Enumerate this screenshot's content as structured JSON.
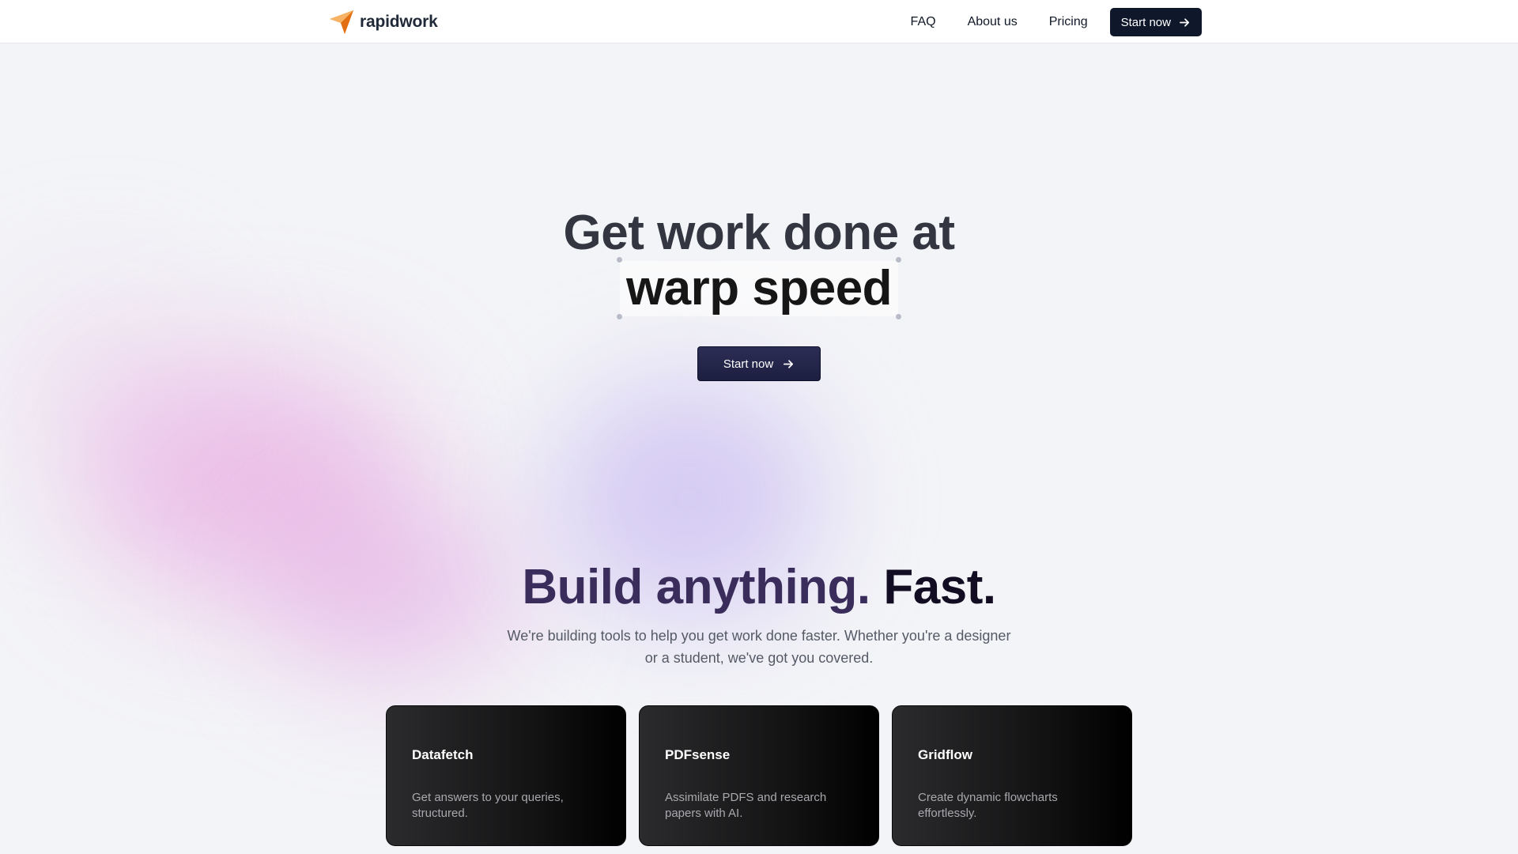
{
  "brand": {
    "name": "rapidwork",
    "accent": "#f28a2c"
  },
  "nav": {
    "links": [
      "FAQ",
      "About us",
      "Pricing"
    ],
    "cta_label": "Start now",
    "cta_icon": "arrow-right-icon"
  },
  "hero": {
    "line1": "Get work done at",
    "line2": "warp speed",
    "cta_label": "Start now",
    "cta_icon": "arrow-right-icon"
  },
  "section": {
    "title_part1": "Build anything.",
    "title_part2": "Fast.",
    "subtitle": "We're building tools to help you get work done faster. Whether you're a designer or a student, we've got you covered."
  },
  "cards": [
    {
      "title": "Datafetch",
      "description": "Get answers to your queries, structured."
    },
    {
      "title": "PDFsense",
      "description": "Assimilate PDFS and research papers with AI."
    },
    {
      "title": "Gridflow",
      "description": "Create dynamic flowcharts effortlessly."
    }
  ]
}
